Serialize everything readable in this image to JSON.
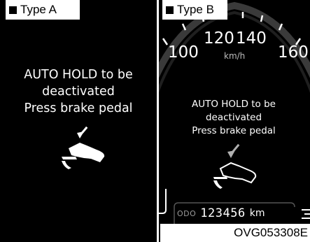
{
  "panel_a": {
    "label": "Type A",
    "message": [
      "AUTO HOLD to be",
      "deactivated",
      "Press brake pedal"
    ],
    "icon": "foot-on-brake-pedal-icon"
  },
  "panel_b": {
    "label": "Type B",
    "speedometer": {
      "ticks": [
        "100",
        "120",
        "140",
        "160"
      ],
      "unit": "km/h"
    },
    "message": [
      "AUTO HOLD to be",
      "deactivated",
      "Press brake pedal"
    ],
    "icon": "foot-on-brake-pedal-icon",
    "odometer": {
      "label": "ODO",
      "value": "123456",
      "unit": "km"
    }
  },
  "caption": "OVG053308E",
  "colors": {
    "screen_background": "#000000",
    "text": "#ffffff",
    "label_background": "#ffffff"
  }
}
